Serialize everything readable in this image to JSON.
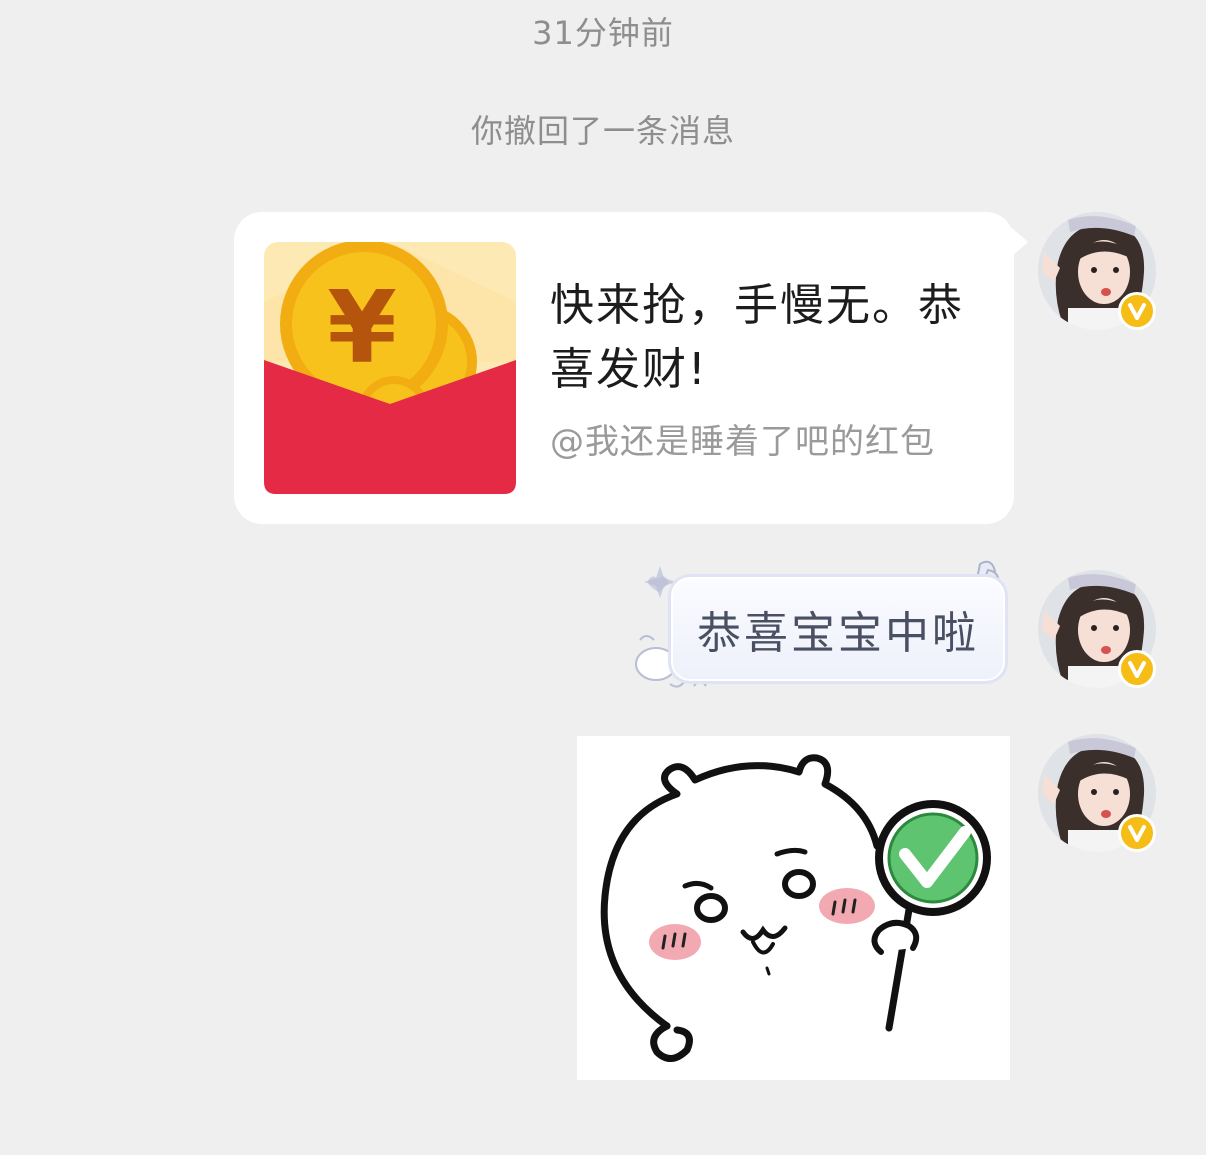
{
  "chat": {
    "timestamp": "31分钟前",
    "recall_notice": "你撤回了一条消息",
    "messages": [
      {
        "type": "red-packet",
        "title": "快来抢，手慢无。恭喜发财!",
        "sender": "@我还是睡着了吧的红包"
      },
      {
        "type": "text",
        "text": "恭喜宝宝中啦"
      },
      {
        "type": "sticker",
        "icon": "bear-sticker-with-checkmark-sign"
      }
    ],
    "avatar_badge": "V"
  },
  "colors": {
    "background": "#efefef",
    "bubble": "#ffffff",
    "envelope_red": "#e42a45",
    "coin_gold": "#f7c21b",
    "badge_gold": "#f6bd16",
    "check_green": "#5fc46f"
  }
}
